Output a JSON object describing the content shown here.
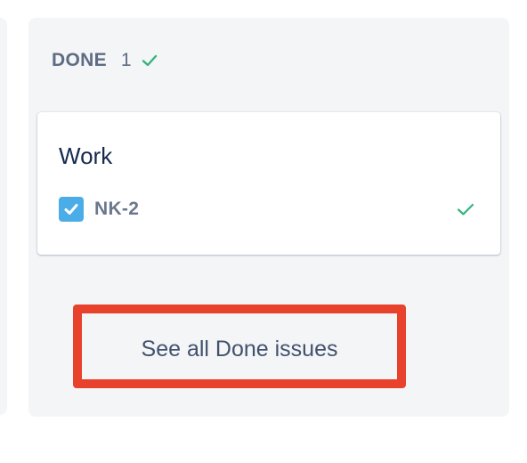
{
  "column": {
    "title": "DONE",
    "count": "1",
    "status_icon": "check-icon",
    "accent_color": "#36b37e"
  },
  "card": {
    "summary": "Work",
    "issue_key": "NK-2",
    "type_icon": "checkbox-task-icon",
    "type_color": "#4bade8",
    "resolved_icon": "check-icon"
  },
  "footer": {
    "see_all_label": "See all Done issues",
    "highlight_color": "#e8412c"
  }
}
